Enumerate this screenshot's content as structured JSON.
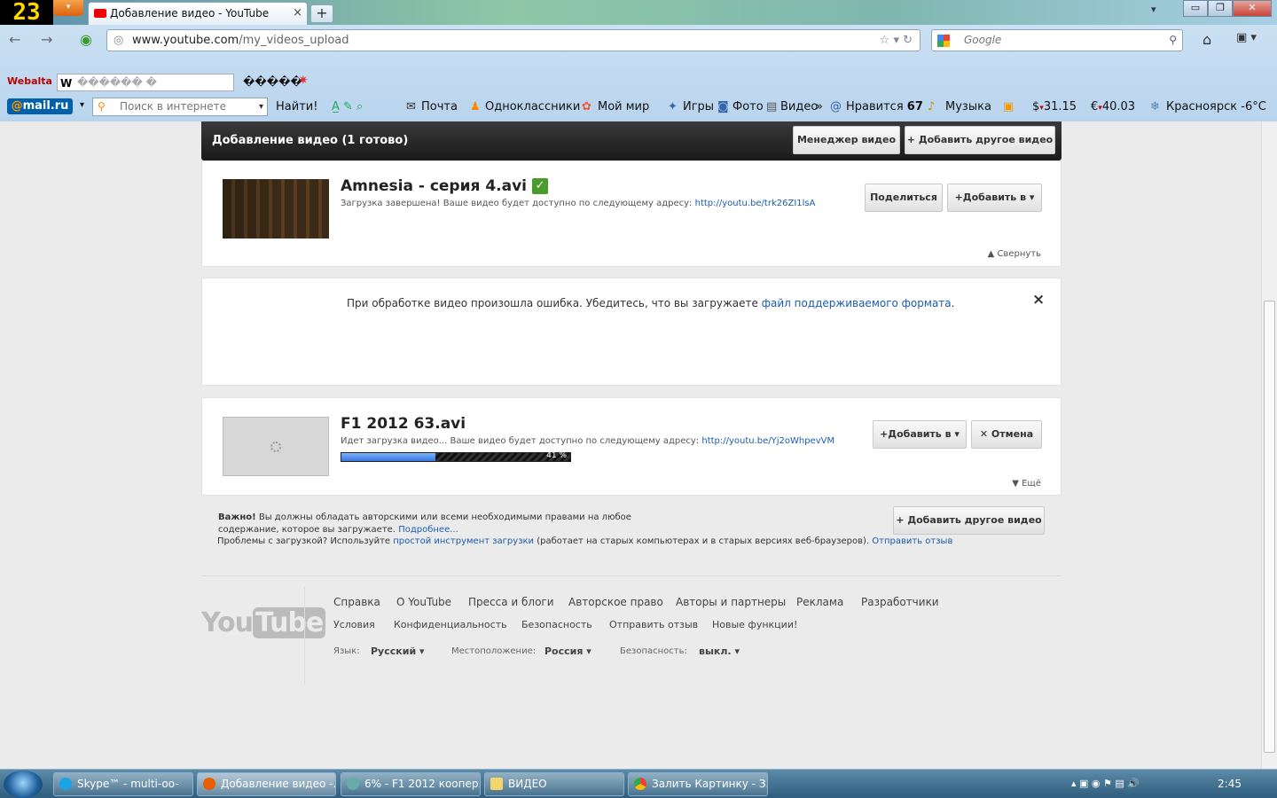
{
  "browser": {
    "fps": "23",
    "tab_title": "Добавление видео - YouTube",
    "tab_close": "×",
    "new_tab": "+",
    "url_host": "www.youtube.com",
    "url_path": "/my_videos_upload",
    "search_placeholder": "Google",
    "win_min": "▭",
    "win_max": "❐",
    "win_close": "✕"
  },
  "toolbar1": {
    "webalta": "Webalta",
    "w_field": "������ � ��������",
    "garbled": "�����",
    "icon_star": "✷"
  },
  "toolbar2": {
    "mailru_at": "@",
    "mailru_text": "mail.ru",
    "search_placeholder": "Поиск в интернете",
    "find": "Найти!",
    "mail": "Почта",
    "ok": "Одноклассники",
    "mymir": "Мой мир",
    "games": "Игры",
    "photo": "Фото",
    "video": "Видео",
    "more": "»",
    "likes": "Нравится",
    "likes_count": "67",
    "music": "Музыка",
    "usd": "31.15",
    "eur": "40.03",
    "weather": "Красноярск -6°C"
  },
  "header": {
    "title": "Добавление видео (1 готово)",
    "manager_button": "Менеджер видео",
    "add_other_button": "Добавить другое видео"
  },
  "video1": {
    "title": "Amnesia - серия 4.avi",
    "status": "Загрузка завершена! Ваше видео будет доступно по следующему адресу:",
    "link": "http://youtu.be/trk26ZI1lsA",
    "share_button": "Поделиться",
    "add_to_button": "Добавить в",
    "collapse": "Свернуть"
  },
  "error": {
    "message": "При обработке видео произошла ошибка. Убедитесь, что вы загружаете",
    "link": "файл поддерживаемого формата",
    "period": ".",
    "close": "×"
  },
  "video2": {
    "title": "F1 2012 63.avi",
    "status": "Идет загрузка видео... Ваше видео будет доступно по следующему адресу:",
    "link": "http://youtu.be/Yj2oWhpevVM",
    "progress": 41,
    "progress_label": "41 %",
    "add_to_button": "Добавить в",
    "cancel_button": "Отмена",
    "more": "Ещё"
  },
  "notice": {
    "important": "Важно!",
    "text1": "Вы должны обладать авторскими или всеми необходимыми правами на любое",
    "text2": "содержание, которое вы загружаете.",
    "more_link": "Подробнее...",
    "problems": "Проблемы с загрузкой? Используйте",
    "simple_tool": "простой инструмент загрузки",
    "old_browsers": "(работает на старых компьютерах и в старых версиях веб-браузеров).",
    "feedback": "Отправить отзыв",
    "add_other_button": "Добавить другое видео"
  },
  "footer": {
    "logo_you": "You",
    "logo_tube": "Tube",
    "row1": [
      "Справка",
      "О YouTube",
      "Пресса и блоги",
      "Авторское право",
      "Авторы и партнеры",
      "Реклама",
      "Разработчики"
    ],
    "row2": [
      "Условия",
      "Конфиденциальность",
      "Безопасность",
      "Отправить отзыв",
      "Новые функции!"
    ],
    "lang_label": "Язык:",
    "lang_value": "Русский",
    "loc_label": "Местоположение:",
    "loc_value": "Россия",
    "safety_label": "Безопасность:",
    "safety_value": "выкл."
  },
  "taskbar": {
    "items": [
      "Skype™ - multi-oo-",
      "Добавление видео -...",
      "6% - F1 2012 коопер...",
      "ВИДЕО",
      "Залить Картинку - З..."
    ],
    "clock": "2:45"
  }
}
